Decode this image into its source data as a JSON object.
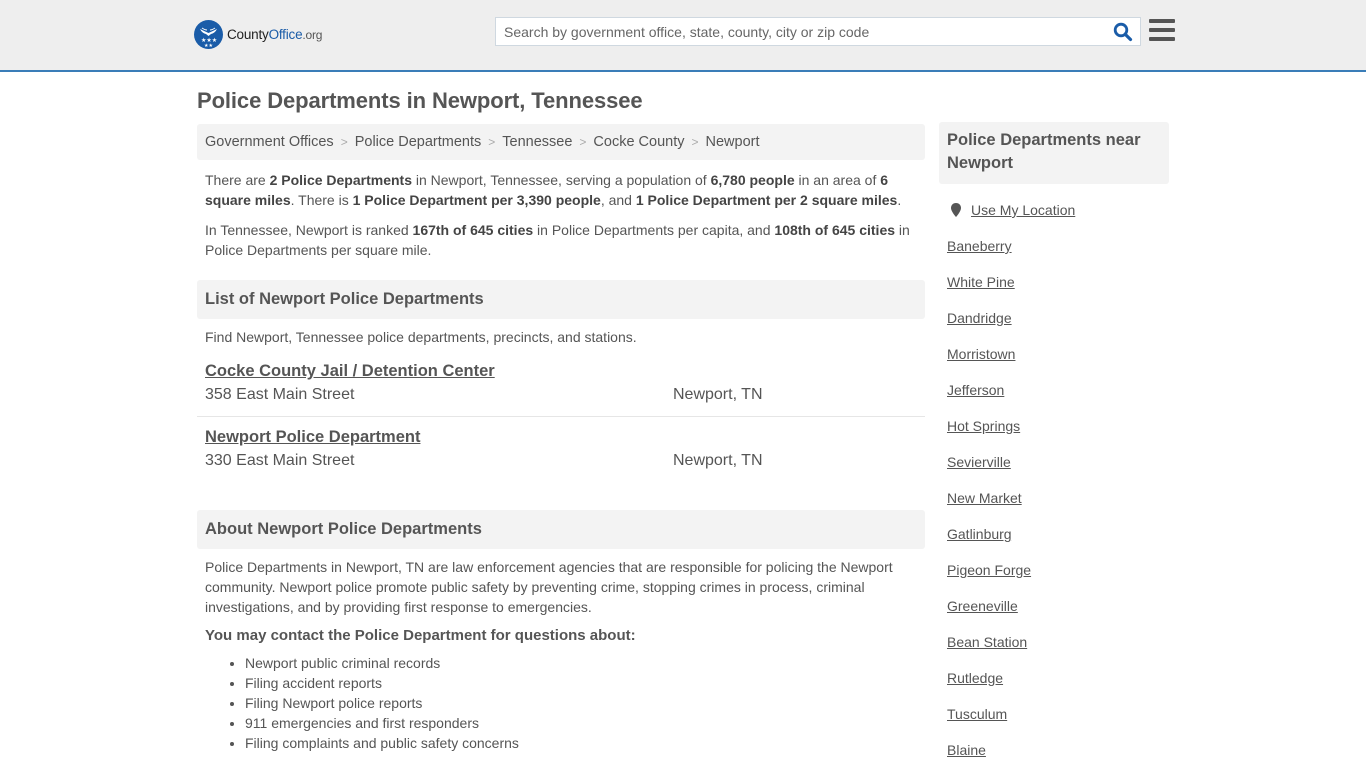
{
  "header": {
    "logo": {
      "county": "County",
      "office": "Office",
      "org": ".org"
    },
    "search": {
      "placeholder": "Search by government office, state, county, city or zip code",
      "value": ""
    },
    "icons": {
      "search": "search-icon",
      "menu": "hamburger-menu-icon",
      "logo": "eagle-stars-logo-icon"
    }
  },
  "page": {
    "title": "Police Departments in Newport, Tennessee"
  },
  "breadcrumb": [
    {
      "label": "Government Offices"
    },
    {
      "label": "Police Departments"
    },
    {
      "label": "Tennessee"
    },
    {
      "label": "Cocke County"
    },
    {
      "label": "Newport"
    }
  ],
  "summary": {
    "p1": {
      "t1": "There are ",
      "b1": "2 Police Departments",
      "t2": " in Newport, Tennessee, serving a population of ",
      "b2": "6,780 people",
      "t3": " in an area of ",
      "b3": "6 square miles",
      "t4": ". There is ",
      "b4": "1 Police Department per 3,390 people",
      "t5": ", and ",
      "b5": "1 Police Department per 2 square miles",
      "t6": "."
    },
    "p2": {
      "t1": "In Tennessee, Newport is ranked ",
      "b1": "167th of 645 cities",
      "t2": " in Police Departments per capita, and ",
      "b2": "108th of 645 cities",
      "t3": " in Police Departments per square mile."
    }
  },
  "list_section": {
    "heading": "List of Newport Police Departments",
    "intro": "Find Newport, Tennessee police departments, precincts, and stations.",
    "entries": [
      {
        "name": "Cocke County Jail / Detention Center",
        "address": "358 East Main Street",
        "city": "Newport, TN"
      },
      {
        "name": "Newport Police Department",
        "address": "330 East Main Street",
        "city": "Newport, TN"
      }
    ]
  },
  "about_section": {
    "heading": "About Newport Police Departments",
    "text": "Police Departments in Newport, TN are law enforcement agencies that are responsible for policing the Newport community. Newport police promote public safety by preventing crime, stopping crimes in process, criminal investigations, and by providing first response to emergencies.",
    "contact_heading": "You may contact the Police Department for questions about:",
    "topics": [
      "Newport public criminal records",
      "Filing accident reports",
      "Filing Newport police reports",
      "911 emergencies and first responders",
      "Filing complaints and public safety concerns"
    ]
  },
  "sidebar": {
    "heading": "Police Departments near Newport",
    "use_location": "Use My Location",
    "location_icon": "map-marker-icon",
    "nearby": [
      "Baneberry",
      "White Pine",
      "Dandridge",
      "Morristown",
      "Jefferson",
      "Hot Springs",
      "Sevierville",
      "New Market",
      "Gatlinburg",
      "Pigeon Forge",
      "Greeneville",
      "Bean Station",
      "Rutledge",
      "Tusculum",
      "Blaine"
    ]
  },
  "colors": {
    "brand_blue": "#1a5ca8",
    "header_border": "#3a7db8",
    "header_bg": "#eeeeee",
    "panel_bg": "#f3f3f3",
    "text": "#555555"
  }
}
